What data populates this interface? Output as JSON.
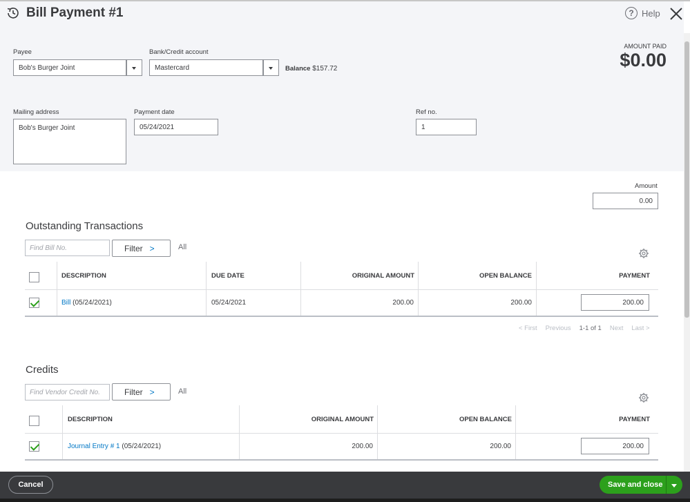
{
  "header": {
    "title": "Bill Payment #1",
    "help_label": "Help",
    "amount_paid_label": "AMOUNT PAID",
    "amount_paid_value": "$0.00"
  },
  "form": {
    "payee_label": "Payee",
    "payee_value": "Bob's Burger Joint",
    "bank_label": "Bank/Credit account",
    "bank_value": "Mastercard",
    "balance_label": "Balance",
    "balance_value": "$157.72",
    "mailing_label": "Mailing address",
    "mailing_value": "Bob's Burger Joint",
    "payment_date_label": "Payment date",
    "payment_date_value": "05/24/2021",
    "ref_label": "Ref no.",
    "ref_value": "1",
    "amount_label": "Amount",
    "amount_value": "0.00"
  },
  "outstanding": {
    "title": "Outstanding Transactions",
    "find_placeholder": "Find Bill No.",
    "filter_label": "Filter",
    "all_label": "All",
    "columns": [
      "DESCRIPTION",
      "DUE DATE",
      "ORIGINAL AMOUNT",
      "OPEN BALANCE",
      "PAYMENT"
    ],
    "rows": [
      {
        "link": "Bill",
        "desc_rest": " (05/24/2021)",
        "due_date": "05/24/2021",
        "original": "200.00",
        "open": "200.00",
        "payment": "200.00",
        "checked": true
      }
    ],
    "pager": {
      "first": "< First",
      "previous": "Previous",
      "range": "1-1 of 1",
      "next": "Next",
      "last": "Last >"
    }
  },
  "credits": {
    "title": "Credits",
    "find_placeholder": "Find Vendor Credit No.",
    "filter_label": "Filter",
    "all_label": "All",
    "columns": [
      "DESCRIPTION",
      "ORIGINAL AMOUNT",
      "OPEN BALANCE",
      "PAYMENT"
    ],
    "rows": [
      {
        "link": "Journal Entry # 1",
        "desc_rest": " (05/24/2021)",
        "original": "200.00",
        "open": "200.00",
        "payment": "200.00",
        "checked": true
      }
    ]
  },
  "footer": {
    "cancel_label": "Cancel",
    "save_label": "Save and close"
  }
}
